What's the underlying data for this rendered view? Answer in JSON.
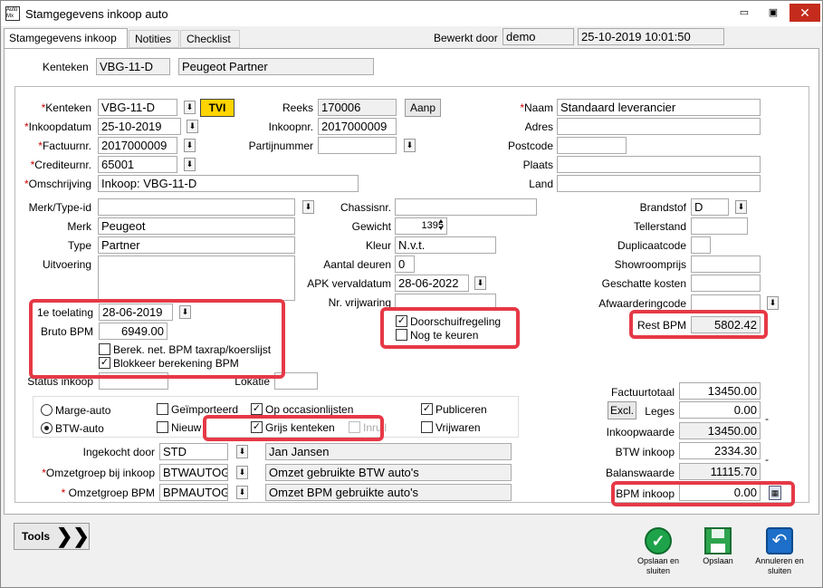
{
  "window": {
    "title": "Stamgegevens inkoop auto"
  },
  "tabs": [
    "Stamgegevens inkoop",
    "Notities",
    "Checklist"
  ],
  "header": {
    "bewerkt_door_label": "Bewerkt door",
    "user": "demo",
    "datetime": "25-10-2019 10:01:50"
  },
  "top": {
    "kenteken_label": "Kenteken",
    "kenteken": "VBG-11-D",
    "model": "Peugeot Partner"
  },
  "left": {
    "kenteken_label": "Kenteken",
    "kenteken": "VBG-11-D",
    "tvi": "TVI",
    "inkoopdatum_label": "Inkoopdatum",
    "inkoopdatum": "25-10-2019",
    "factuurnr_label": "Factuurnr.",
    "factuurnr": "2017000009",
    "crediteurnr_label": "Crediteurnr.",
    "crediteurnr": "65001",
    "omschrijving_label": "Omschrijving",
    "omschrijving": "Inkoop: VBG-11-D",
    "reeks_label": "Reeks",
    "reeks": "170006",
    "aanp": "Aanp",
    "inkoopnr_label": "Inkoopnr.",
    "inkoopnr": "2017000009",
    "partijnummer_label": "Partijnummer",
    "partijnummer": ""
  },
  "supplier": {
    "naam_label": "Naam",
    "naam": "Standaard leverancier",
    "adres_label": "Adres",
    "postcode_label": "Postcode",
    "plaats_label": "Plaats",
    "land_label": "Land"
  },
  "vehicle": {
    "merktype_label": "Merk/Type-id",
    "merk_label": "Merk",
    "merk": "Peugeot",
    "type_label": "Type",
    "type": "Partner",
    "uitvoering_label": "Uitvoering",
    "toelating_label": "1e toelating",
    "toelating": "28-06-2019",
    "bruto_bpm_label": "Bruto BPM",
    "bruto_bpm": "6949.00",
    "berek_label": "Berek. net. BPM taxrap/koerslijst",
    "blokkeer_label": "Blokkeer berekening BPM",
    "status_label": "Status inkoop",
    "lokatie_label": "Lokatie",
    "chassis_label": "Chassisnr.",
    "gewicht_label": "Gewicht",
    "gewicht": "1395",
    "kleur_label": "Kleur",
    "kleur": "N.v.t.",
    "deuren_label": "Aantal deuren",
    "deuren": "0",
    "apk_label": "APK vervaldatum",
    "apk": "28-06-2022",
    "vrijwaring_label": "Nr. vrijwaring",
    "doorschuif_label": "Doorschuifregeling",
    "nog_label": "Nog te keuren",
    "brandstof_label": "Brandstof",
    "brandstof": "D",
    "tellerstand_label": "Tellerstand",
    "duplicaat_label": "Duplicaatcode",
    "showroom_label": "Showroomprijs",
    "geschatte_label": "Geschatte kosten",
    "afwaardering_label": "Afwaarderingcode",
    "rest_bpm_label": "Rest BPM",
    "rest_bpm": "5802.42"
  },
  "options": {
    "marge": "Marge-auto",
    "btw": "BTW-auto",
    "geimporteerd": "Geïmporteerd",
    "nieuw": "Nieuw",
    "op_occasion": "Op occasionlijsten",
    "grijs": "Grijs kenteken",
    "inruil": "Inruil",
    "publiceren": "Publiceren",
    "vrijwaren": "Vrijwaren"
  },
  "bottom": {
    "ingekocht_label": "Ingekocht door",
    "ingekocht": "STD",
    "ingekocht_naam": "Jan Jansen",
    "omzet_inkoop_label": "Omzetgroep bij inkoop",
    "omzet_inkoop": "BTWAUTOG",
    "omzet_inkoop_naam": "Omzet gebruikte BTW auto's",
    "omzet_bpm_label": "Omzetgroep BPM",
    "omzet_bpm": "BPMAUTOG",
    "omzet_bpm_naam": "Omzet BPM gebruikte auto's"
  },
  "totals": {
    "factuurtotaal_label": "Factuurtotaal",
    "factuurtotaal": "13450.00",
    "excl": "Excl.",
    "leges_label": "Leges",
    "leges": "0.00",
    "inkoopwaarde_label": "Inkoopwaarde",
    "inkoopwaarde": "13450.00",
    "btw_label": "BTW inkoop",
    "btw": "2334.30",
    "balans_label": "Balanswaarde",
    "balans": "11115.70",
    "bpm_label": "BPM inkoop",
    "bpm": "0.00"
  },
  "footer": {
    "tools": "Tools",
    "opslaan_sluiten": "Opslaan en sluiten",
    "opslaan": "Opslaan",
    "annuleren": "Annuleren en sluiten"
  }
}
